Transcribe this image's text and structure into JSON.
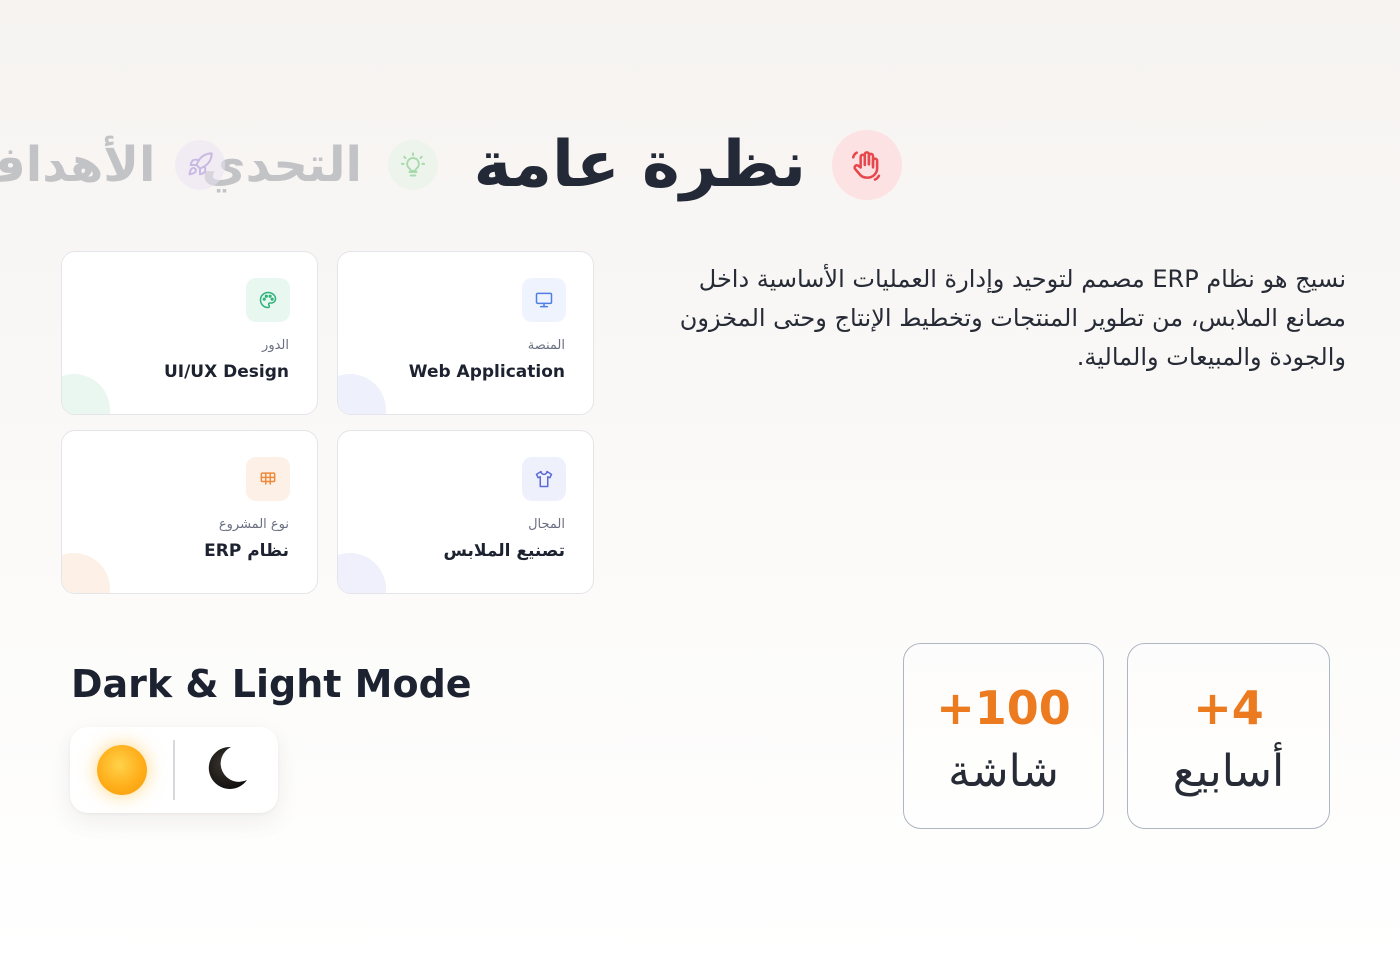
{
  "tabs": {
    "overview": {
      "label": "نظرة عامة",
      "icon": "hand-wave-icon",
      "color": "#e5484d"
    },
    "challenge": {
      "label": "التحدي",
      "icon": "lightbulb-icon",
      "color": "#5cbf6a"
    },
    "goals": {
      "label": "الأهداف",
      "icon": "rocket-icon",
      "color": "#9b7fd4"
    }
  },
  "description": "نسيج هو نظام ERP مصمم لتوحيد وإدارة العمليات الأساسية داخل مصانع الملابس، من تطوير المنتجات وتخطيط الإنتاج وحتى المخزون والجودة والمبيعات والمالية.",
  "cards": {
    "platform": {
      "label": "المنصة",
      "value": "Web Application",
      "icon": "monitor-icon",
      "color": "#4f7fe6",
      "tint": "#eef3fd"
    },
    "role": {
      "label": "الدور",
      "value": "UI/UX Design",
      "icon": "palette-icon",
      "color": "#2eb37a",
      "tint": "#e8f7ef"
    },
    "domain": {
      "label": "المجال",
      "value": "تصنيع الملابس",
      "icon": "tshirt-icon",
      "color": "#5c6ad6",
      "tint": "#eef0fc"
    },
    "type": {
      "label": "نوع المشروع",
      "value": "نظام ERP",
      "icon": "grid-icon",
      "color": "#ee8a3a",
      "tint": "#fdf0e6"
    }
  },
  "mode": {
    "title": "Dark & Light Mode",
    "light_icon": "sun-icon",
    "dark_icon": "moon-icon",
    "sun_color": "#ffae1a"
  },
  "stats": {
    "weeks": {
      "value": "+4",
      "label": "أسابيع"
    },
    "screens": {
      "value": "+100",
      "label": "شاشة"
    },
    "accent": "#ec7a1e"
  }
}
